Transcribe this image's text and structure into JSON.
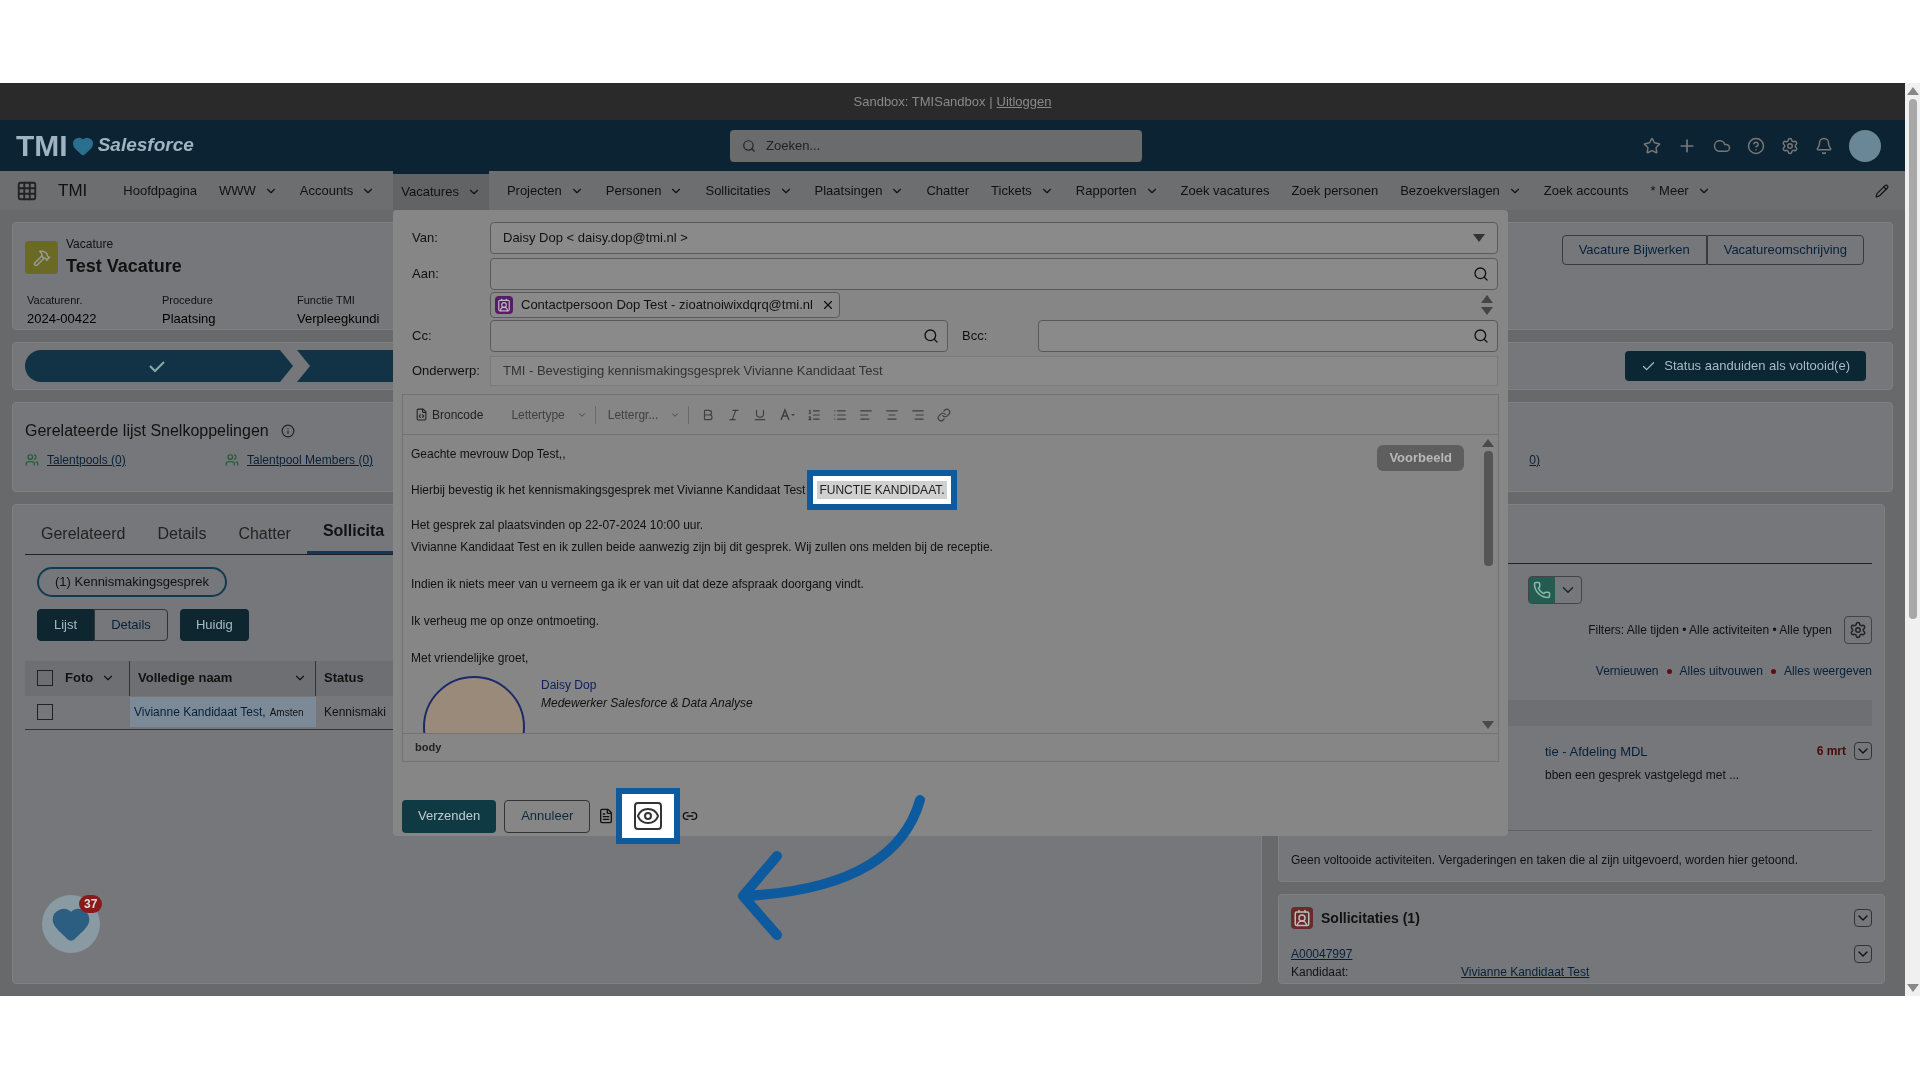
{
  "system_bar": {
    "text": "Sandbox: TMISandbox |",
    "link": "Uitloggen"
  },
  "header": {
    "logo_text": "TMI",
    "logo_subtitle": "Salesforce",
    "search": {
      "placeholder": "Zoeken..."
    }
  },
  "nav": {
    "app_name": "TMI",
    "items": [
      {
        "label": "Hoofdpagina",
        "dropdown": false,
        "selected": false
      },
      {
        "label": "WWW",
        "dropdown": true,
        "selected": false
      },
      {
        "label": "Accounts",
        "dropdown": true,
        "selected": false
      },
      {
        "label": "Vacatures",
        "dropdown": true,
        "selected": true
      },
      {
        "label": "Projecten",
        "dropdown": true,
        "selected": false
      },
      {
        "label": "Personen",
        "dropdown": true,
        "selected": false
      },
      {
        "label": "Sollicitaties",
        "dropdown": true,
        "selected": false
      },
      {
        "label": "Plaatsingen",
        "dropdown": true,
        "selected": false
      },
      {
        "label": "Chatter",
        "dropdown": false,
        "selected": false
      },
      {
        "label": "Tickets",
        "dropdown": true,
        "selected": false
      },
      {
        "label": "Rapporten",
        "dropdown": true,
        "selected": false
      },
      {
        "label": "Zoek vacatures",
        "dropdown": false,
        "selected": false
      },
      {
        "label": "Zoek personen",
        "dropdown": false,
        "selected": false
      },
      {
        "label": "Bezoekverslagen",
        "dropdown": true,
        "selected": false
      },
      {
        "label": "Zoek accounts",
        "dropdown": false,
        "selected": false
      },
      {
        "label": "* Meer",
        "dropdown": true,
        "selected": false
      }
    ]
  },
  "record": {
    "object": "Vacature",
    "title": "Test Vacature",
    "fields": [
      {
        "label": "Vacaturenr.",
        "value": "2024-00422"
      },
      {
        "label": "Procedure",
        "value": "Plaatsing"
      },
      {
        "label": "Functie TMI",
        "value": "Verpleegkundi"
      }
    ],
    "actions": [
      "Vacature Bijwerken",
      "Vacatureomschrijving"
    ]
  },
  "path": {
    "status_button": "Status aanduiden als voltooid(e)"
  },
  "quick_links": {
    "title": "Gerelateerde lijst Snelkoppelingen",
    "links": [
      "Talentpools (0)",
      "Talentpool Members (0)",
      "0)"
    ]
  },
  "tabs": [
    {
      "label": "Gerelateerd",
      "selected": false
    },
    {
      "label": "Details",
      "selected": false
    },
    {
      "label": "Chatter",
      "selected": false
    },
    {
      "label": "Sollicita",
      "selected": true
    }
  ],
  "filter_pill": "(1) Kennismakingsgesprek",
  "view_toggle": [
    {
      "label": "Lijst",
      "selected": true
    },
    {
      "label": "Details",
      "selected": false
    }
  ],
  "current_button": "Huidig",
  "table": {
    "select_all_checked": false,
    "columns": [
      "Foto",
      "Volledige naam",
      "Status"
    ],
    "rows": [
      {
        "checked": false,
        "name": "Vivianne Kandidaat Test,",
        "location": "Amsten",
        "status": "Kennismaki"
      }
    ]
  },
  "activity": {
    "filters": "Filters: Alle tijden • Alle activiteiten • Alle typen",
    "links": [
      "Vernieuwen",
      "Alles uitvouwen",
      "Alles weergeven"
    ],
    "item": {
      "title": "tie - Afdeling MDL",
      "description": "bben een gesprek vastgelegd met ...",
      "date": "6 mrt"
    },
    "empty_text": "Geen voltooide activiteiten. Vergaderingen en taken die al zijn uitgevoerd, worden hier getoond."
  },
  "applications": {
    "title": "Sollicitaties (1)",
    "record_id": "A00047997",
    "label": "Kandidaat:",
    "candidate": "Vivianne Kandidaat Test"
  },
  "notification_badge": "37",
  "email": {
    "from": {
      "label": "Van:",
      "value": "Daisy Dop < daisy.dop@tmi.nl >"
    },
    "to": {
      "label": "Aan:",
      "recipients": [
        "Contactpersoon Dop Test - zioatnoiwixdqrq@tmi.nl"
      ]
    },
    "cc": {
      "label": "Cc:"
    },
    "bcc": {
      "label": "Bcc:"
    },
    "subject": {
      "label": "Onderwerp:",
      "value": "TMI - Bevestiging kennismakingsgesprek Vivianne Kandidaat Test"
    },
    "toolbar": {
      "source": "Broncode",
      "font": "Lettertype",
      "size": "Lettergr..."
    },
    "preview_button": "Voorbeeld",
    "body": [
      {
        "kind": "text",
        "lines": [
          "Geachte mevrouw Dop Test,,"
        ]
      },
      {
        "kind": "merge",
        "text": "Hierbij bevestig ik het kennismakingsgesprek met Vivianne Kandidaat Test",
        "field": "FUNCTIE KANDIDAAT."
      },
      {
        "kind": "text",
        "lines": [
          "Het gesprek zal plaatsvinden op 22-07-2024 10:00 uur.",
          "Vivianne Kandidaat Test en ik zullen beide aanwezig zijn bij dit gesprek. Wij zullen ons melden bij de receptie."
        ]
      },
      {
        "kind": "text",
        "lines": [
          "Indien ik niets meer van u verneem ga ik er van uit dat deze afspraak doorgang vindt."
        ]
      },
      {
        "kind": "text",
        "lines": [
          "Ik verheug me op onze ontmoeting."
        ]
      },
      {
        "kind": "text",
        "lines": [
          "Met vriendelijke groet,"
        ]
      }
    ],
    "signature": {
      "name": "Daisy Dop",
      "role": "Medewerker Salesforce & Data Analyse"
    },
    "element_path": "body",
    "send": "Verzenden",
    "cancel": "Annuleer"
  }
}
